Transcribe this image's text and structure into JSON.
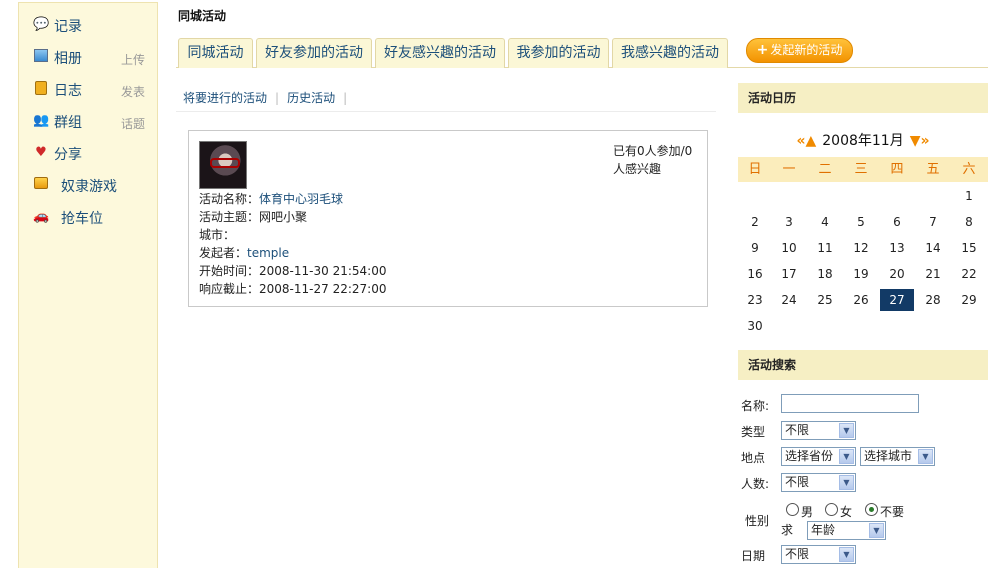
{
  "sidebar": {
    "items": [
      {
        "label": "记录",
        "icon": "chat-bubble-icon",
        "sub": ""
      },
      {
        "label": "相册",
        "icon": "photo-icon",
        "sub": "上传"
      },
      {
        "label": "日志",
        "icon": "notebook-icon",
        "sub": "发表"
      },
      {
        "label": "群组",
        "icon": "group-icon",
        "sub": "话题"
      },
      {
        "label": "分享",
        "icon": "hearts-icon",
        "sub": ""
      },
      {
        "label": "奴隶游戏",
        "icon": "game-icon",
        "sub": ""
      },
      {
        "label": "抢车位",
        "icon": "car-icon",
        "sub": ""
      }
    ]
  },
  "page_title": "同城活动",
  "tabs": [
    {
      "label": "同城活动"
    },
    {
      "label": "好友参加的活动"
    },
    {
      "label": "好友感兴趣的活动"
    },
    {
      "label": "我参加的活动"
    },
    {
      "label": "我感兴趣的活动"
    }
  ],
  "new_activity_button": "发起新的活动",
  "subnav": {
    "upcoming": "将要进行的活动",
    "history": "历史活动"
  },
  "activity": {
    "name_label": "活动名称：",
    "name": "体育中心羽毛球",
    "theme_label": "活动主题：",
    "theme": "网吧小聚",
    "city_label": "城市：",
    "city": "",
    "organizer_label": "发起者：",
    "organizer": "temple",
    "start_label": "开始时间：",
    "start": "2008-11-30 21:54:00",
    "deadline_label": "响应截止：",
    "deadline": "2008-11-27 22:27:00",
    "join_info": "已有0人参加/0人感兴趣"
  },
  "calendar": {
    "panel_title": "活动日历",
    "prev": "«",
    "prev_month": "▲",
    "title": "2008年11月",
    "next_month": "▼",
    "next": "»",
    "weekdays": [
      "日",
      "一",
      "二",
      "三",
      "四",
      "五",
      "六"
    ],
    "first_weekday": 6,
    "days_in_month": 30,
    "today": 27
  },
  "search": {
    "panel_title": "活动搜索",
    "name_label": "名称:",
    "name_value": "",
    "type_label": "类型",
    "type_value": "不限",
    "location_label": "地点",
    "province_value": "选择省份",
    "city_value": "选择城市",
    "people_label": "人数:",
    "people_value": "不限",
    "gender_label": "性别",
    "gender_options": [
      "男",
      "女",
      "不要求"
    ],
    "gender_selected": 2,
    "age_value": "年龄",
    "date_label": "日期",
    "date_value": "不限"
  }
}
